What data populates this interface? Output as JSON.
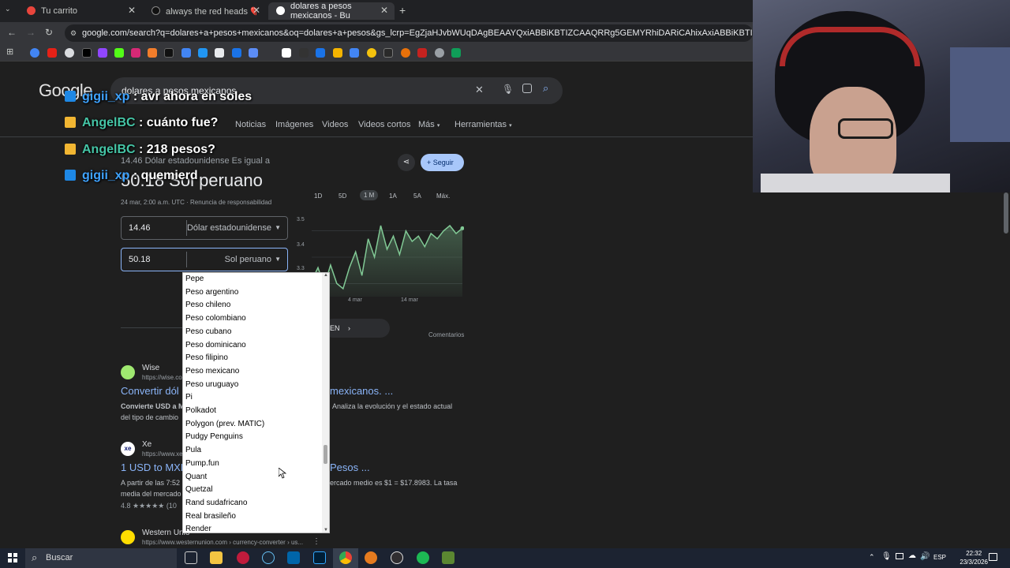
{
  "browser": {
    "tabs": [
      {
        "title": "Tu carrito",
        "active": false
      },
      {
        "title": "always the red heads 💔 #yan",
        "active": false
      },
      {
        "title": "dolares a pesos mexicanos - Bu",
        "active": true
      }
    ],
    "url": "google.com/search?q=dolares+a+pesos+mexicanos&oq=dolares+a+pesos&gs_lcrp=EgZjaHJvbWUqDAgBEAAYQxiABBiKBTIZCAAQRRg5GEMYRhiDARiCAhixAxiABBiKBTIMCAEQABhDGIAEGIoFMgwIAhAAGEM"
  },
  "google": {
    "logo": "Google",
    "query": "dolares a pesos mexicanos",
    "tabs": [
      "Noticias",
      "Imágenes",
      "Videos",
      "Videos cortos",
      "Más",
      "Herramientas"
    ],
    "converter": {
      "subtitle": "14.46 Dólar estadounidense Es igual a",
      "result": "50.18 Sol peruano",
      "timestamp": "24 mar, 2:00 a.m. UTC · Renuncia de responsabilidad",
      "follow_label": "Seguir",
      "ranges": [
        "1D",
        "5D",
        "1 M",
        "1A",
        "5A",
        "Máx."
      ],
      "from_value": "14.46",
      "from_currency": "Dólar estadounidense",
      "to_value": "50.18",
      "to_currency": "Sol peruano",
      "chart_y_labels": [
        "3.5",
        "3.4",
        "3.3"
      ],
      "chart_x_labels": [
        "4 mar",
        "14 mar"
      ],
      "chart_values": [
        3.31,
        3.36,
        3.29,
        3.37,
        3.3,
        3.28,
        3.36,
        3.42,
        3.33,
        3.47,
        3.4,
        3.52,
        3.43,
        3.48,
        3.41,
        3.5,
        3.46,
        3.48,
        3.44,
        3.49,
        3.47,
        3.5,
        3.52,
        3.49,
        3.51
      ],
      "more_label": "EN",
      "feedback": "Comentarios"
    },
    "results": [
      {
        "site": "Wise",
        "url": "https://wise.com",
        "title": "Convertir dól",
        "title_tail": "mexicanos. ...",
        "snippet_lead": "Convierte USD a M",
        "snippet": "del tipo de cambio",
        "snippet_tail": "Analiza la evolución y el estado actual"
      },
      {
        "site": "Xe",
        "url": "https://www.xe.com",
        "title": "1 USD to MXN",
        "title_tail": "Pesos ...",
        "snippet": "A partir de las 7:52",
        "snippet2": "media del mercado",
        "snippet_tail": "ercado medio es $1 = $17.8983. La tasa",
        "rating": "4.8 ★★★★★ (10"
      },
      {
        "site": "Western Unio",
        "url": "https://www.westernunion.com › currency-converter › us..."
      }
    ],
    "dropdown": {
      "items": [
        "Pepe",
        "Peso argentino",
        "Peso chileno",
        "Peso colombiano",
        "Peso cubano",
        "Peso dominicano",
        "Peso filipino",
        "Peso mexicano",
        "Peso uruguayo",
        "Pi",
        "Polkadot",
        "Polygon (prev. MATIC)",
        "Pudgy Penguins",
        "Pula",
        "Pump.fun",
        "Quant",
        "Quetzal",
        "Rand sudafricano",
        "Real brasileño",
        "Render"
      ]
    }
  },
  "chat": [
    {
      "user": "gigii_xp",
      "message": ": avr ahora en soles"
    },
    {
      "user": "AngelBC",
      "message": ": cuánto fue?"
    },
    {
      "user": "AngelBC",
      "message": ": 218 pesos?"
    },
    {
      "user": "gigii_xp",
      "message": ": quemierd"
    }
  ],
  "taskbar": {
    "search_placeholder": "Buscar",
    "language": "ESP",
    "time": "22:32",
    "date": "23/3/2026"
  },
  "colors": {
    "accent_blue": "#8ab4f8",
    "chart_green": "#81c995",
    "page_bg": "#1f1f1f"
  }
}
